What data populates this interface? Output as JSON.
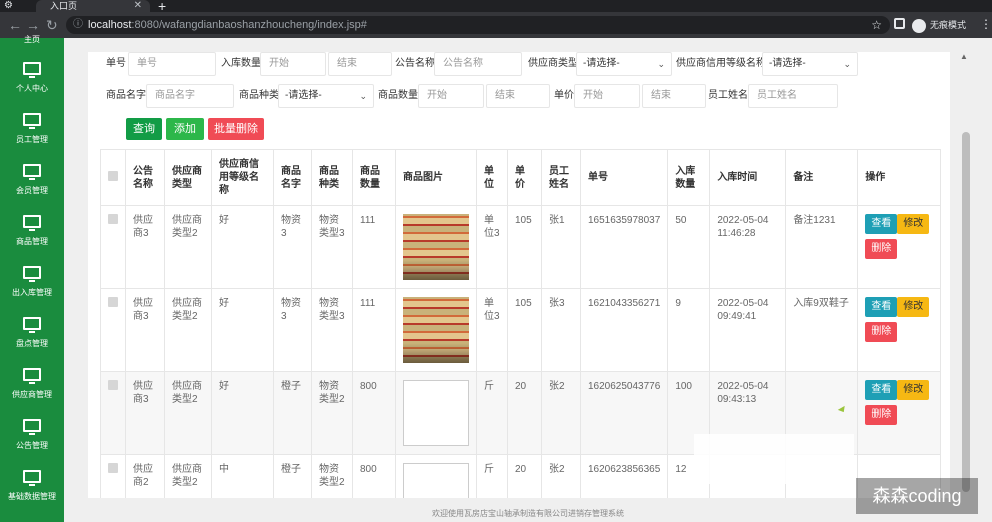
{
  "browser": {
    "tab_title": "入口页",
    "url_host": "localhost",
    "url_path": ":8080/wafangdianbaoshanzhoucheng/index.jsp#",
    "incognito_label": "无痕模式"
  },
  "sidebar": {
    "top_partial": "主页",
    "items": [
      {
        "label": "个人中心"
      },
      {
        "label": "员工管理"
      },
      {
        "label": "会员管理"
      },
      {
        "label": "商品管理"
      },
      {
        "label": "出入库管理"
      },
      {
        "label": "盘点管理"
      },
      {
        "label": "供应商管理"
      },
      {
        "label": "公告管理"
      },
      {
        "label": "基础数据管理"
      }
    ]
  },
  "filters": {
    "row1": [
      {
        "label": "单号",
        "placeholder": "单号"
      },
      {
        "label": "入库数量",
        "placeholder_from": "开始",
        "placeholder_to": "结束"
      },
      {
        "label": "公告名称",
        "placeholder": "公告名称"
      },
      {
        "label": "供应商类型",
        "selected": "-请选择-"
      },
      {
        "label": "供应商信用等级名称",
        "selected": "-请选择-"
      }
    ],
    "row2": [
      {
        "label": "商品名字",
        "placeholder": "商品名字"
      },
      {
        "label": "商品种类",
        "selected": "-请选择-"
      },
      {
        "label": "商品数量",
        "placeholder_from": "开始",
        "placeholder_to": "结束"
      },
      {
        "label": "单价",
        "placeholder_from": "开始",
        "placeholder_to": "结束"
      },
      {
        "label": "员工姓名",
        "placeholder": "员工姓名"
      }
    ]
  },
  "buttons": {
    "search": "查询",
    "add": "添加",
    "batch_delete": "批量删除"
  },
  "table": {
    "headers": [
      "公告名称",
      "供应商类型",
      "供应商信用等级名称",
      "商品名字",
      "商品种类",
      "商品数量",
      "商品图片",
      "单位",
      "单价",
      "员工姓名",
      "单号",
      "入库数量",
      "入库时间",
      "备注",
      "操作"
    ],
    "rows": [
      {
        "notice": "供应商3",
        "stype": "供应商类型2",
        "credit": "好",
        "goods": "物资3",
        "kind": "物资类型3",
        "qty": "111",
        "img": "photo",
        "unit": "单位3",
        "price": "105",
        "emp": "张1",
        "no": "1651635978037",
        "inqty": "50",
        "time": "2022-05-04 11:46:28",
        "note": "备注1231"
      },
      {
        "notice": "供应商3",
        "stype": "供应商类型2",
        "credit": "好",
        "goods": "物资3",
        "kind": "物资类型3",
        "qty": "111",
        "img": "photo",
        "unit": "单位3",
        "price": "105",
        "emp": "张3",
        "no": "1621043356271",
        "inqty": "9",
        "time": "2022-05-04 09:49:41",
        "note": "入库9双鞋子"
      },
      {
        "notice": "供应商3",
        "stype": "供应商类型2",
        "credit": "好",
        "goods": "橙子",
        "kind": "物资类型2",
        "qty": "800",
        "img": "broken",
        "unit": "斤",
        "price": "20",
        "emp": "张2",
        "no": "1620625043776",
        "inqty": "100",
        "time": "2022-05-04 09:43:13",
        "note": ""
      },
      {
        "notice": "供应商2",
        "stype": "供应商类型2",
        "credit": "中",
        "goods": "橙子",
        "kind": "物资类型2",
        "qty": "800",
        "img": "broken",
        "unit": "斤",
        "price": "20",
        "emp": "张2",
        "no": "1620623856365",
        "inqty": "12",
        "time": "",
        "note": ""
      }
    ],
    "ops": {
      "view": "查看",
      "edit": "修改",
      "delete": "删除"
    }
  },
  "footer": "欢迎使用瓦房店宝山轴承制造有限公司进销存管理系统",
  "watermark": "森森coding"
}
